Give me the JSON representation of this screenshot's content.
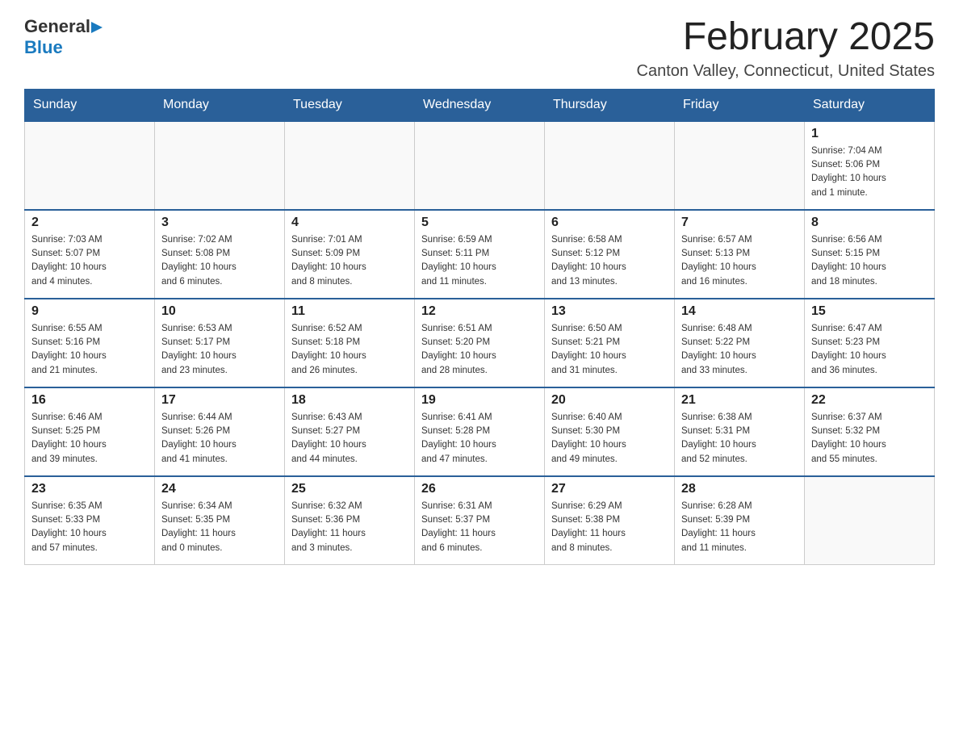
{
  "logo": {
    "general": "General",
    "blue": "Blue"
  },
  "header": {
    "month": "February 2025",
    "location": "Canton Valley, Connecticut, United States"
  },
  "weekdays": [
    "Sunday",
    "Monday",
    "Tuesday",
    "Wednesday",
    "Thursday",
    "Friday",
    "Saturday"
  ],
  "weeks": [
    [
      {
        "day": "",
        "info": ""
      },
      {
        "day": "",
        "info": ""
      },
      {
        "day": "",
        "info": ""
      },
      {
        "day": "",
        "info": ""
      },
      {
        "day": "",
        "info": ""
      },
      {
        "day": "",
        "info": ""
      },
      {
        "day": "1",
        "info": "Sunrise: 7:04 AM\nSunset: 5:06 PM\nDaylight: 10 hours\nand 1 minute."
      }
    ],
    [
      {
        "day": "2",
        "info": "Sunrise: 7:03 AM\nSunset: 5:07 PM\nDaylight: 10 hours\nand 4 minutes."
      },
      {
        "day": "3",
        "info": "Sunrise: 7:02 AM\nSunset: 5:08 PM\nDaylight: 10 hours\nand 6 minutes."
      },
      {
        "day": "4",
        "info": "Sunrise: 7:01 AM\nSunset: 5:09 PM\nDaylight: 10 hours\nand 8 minutes."
      },
      {
        "day": "5",
        "info": "Sunrise: 6:59 AM\nSunset: 5:11 PM\nDaylight: 10 hours\nand 11 minutes."
      },
      {
        "day": "6",
        "info": "Sunrise: 6:58 AM\nSunset: 5:12 PM\nDaylight: 10 hours\nand 13 minutes."
      },
      {
        "day": "7",
        "info": "Sunrise: 6:57 AM\nSunset: 5:13 PM\nDaylight: 10 hours\nand 16 minutes."
      },
      {
        "day": "8",
        "info": "Sunrise: 6:56 AM\nSunset: 5:15 PM\nDaylight: 10 hours\nand 18 minutes."
      }
    ],
    [
      {
        "day": "9",
        "info": "Sunrise: 6:55 AM\nSunset: 5:16 PM\nDaylight: 10 hours\nand 21 minutes."
      },
      {
        "day": "10",
        "info": "Sunrise: 6:53 AM\nSunset: 5:17 PM\nDaylight: 10 hours\nand 23 minutes."
      },
      {
        "day": "11",
        "info": "Sunrise: 6:52 AM\nSunset: 5:18 PM\nDaylight: 10 hours\nand 26 minutes."
      },
      {
        "day": "12",
        "info": "Sunrise: 6:51 AM\nSunset: 5:20 PM\nDaylight: 10 hours\nand 28 minutes."
      },
      {
        "day": "13",
        "info": "Sunrise: 6:50 AM\nSunset: 5:21 PM\nDaylight: 10 hours\nand 31 minutes."
      },
      {
        "day": "14",
        "info": "Sunrise: 6:48 AM\nSunset: 5:22 PM\nDaylight: 10 hours\nand 33 minutes."
      },
      {
        "day": "15",
        "info": "Sunrise: 6:47 AM\nSunset: 5:23 PM\nDaylight: 10 hours\nand 36 minutes."
      }
    ],
    [
      {
        "day": "16",
        "info": "Sunrise: 6:46 AM\nSunset: 5:25 PM\nDaylight: 10 hours\nand 39 minutes."
      },
      {
        "day": "17",
        "info": "Sunrise: 6:44 AM\nSunset: 5:26 PM\nDaylight: 10 hours\nand 41 minutes."
      },
      {
        "day": "18",
        "info": "Sunrise: 6:43 AM\nSunset: 5:27 PM\nDaylight: 10 hours\nand 44 minutes."
      },
      {
        "day": "19",
        "info": "Sunrise: 6:41 AM\nSunset: 5:28 PM\nDaylight: 10 hours\nand 47 minutes."
      },
      {
        "day": "20",
        "info": "Sunrise: 6:40 AM\nSunset: 5:30 PM\nDaylight: 10 hours\nand 49 minutes."
      },
      {
        "day": "21",
        "info": "Sunrise: 6:38 AM\nSunset: 5:31 PM\nDaylight: 10 hours\nand 52 minutes."
      },
      {
        "day": "22",
        "info": "Sunrise: 6:37 AM\nSunset: 5:32 PM\nDaylight: 10 hours\nand 55 minutes."
      }
    ],
    [
      {
        "day": "23",
        "info": "Sunrise: 6:35 AM\nSunset: 5:33 PM\nDaylight: 10 hours\nand 57 minutes."
      },
      {
        "day": "24",
        "info": "Sunrise: 6:34 AM\nSunset: 5:35 PM\nDaylight: 11 hours\nand 0 minutes."
      },
      {
        "day": "25",
        "info": "Sunrise: 6:32 AM\nSunset: 5:36 PM\nDaylight: 11 hours\nand 3 minutes."
      },
      {
        "day": "26",
        "info": "Sunrise: 6:31 AM\nSunset: 5:37 PM\nDaylight: 11 hours\nand 6 minutes."
      },
      {
        "day": "27",
        "info": "Sunrise: 6:29 AM\nSunset: 5:38 PM\nDaylight: 11 hours\nand 8 minutes."
      },
      {
        "day": "28",
        "info": "Sunrise: 6:28 AM\nSunset: 5:39 PM\nDaylight: 11 hours\nand 11 minutes."
      },
      {
        "day": "",
        "info": ""
      }
    ]
  ]
}
